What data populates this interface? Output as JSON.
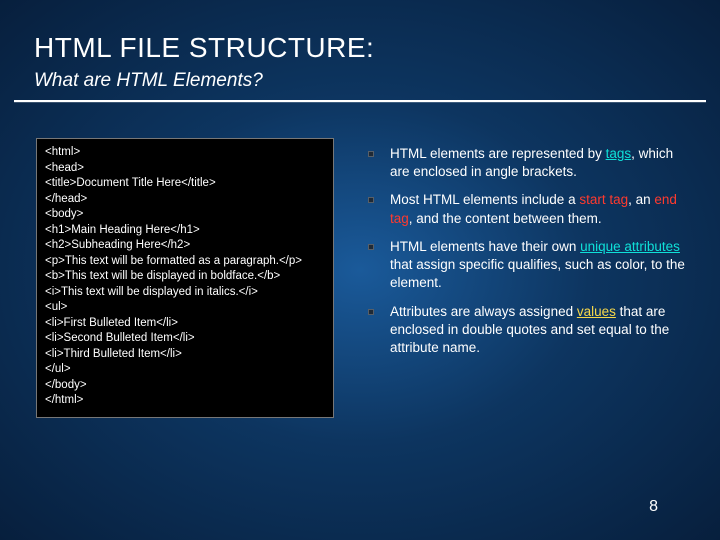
{
  "header": {
    "title": "HTML FILE STRUCTURE:",
    "subtitle": "What are HTML Elements?"
  },
  "code": {
    "lines": [
      "<html>",
      "<head>",
      "<title>Document Title Here</title>",
      "</head>",
      "",
      "<body>",
      "<h1>Main Heading Here</h1>",
      "<h2>Subheading Here</h2>",
      "",
      "<p>This text will be formatted as a paragraph.</p>",
      "<b>This text will be displayed in boldface.</b>",
      "<i>This text will be displayed in italics.</i>",
      "",
      "<ul>",
      "<li>First Bulleted Item</li>",
      "<li>Second Bulleted Item</li>",
      "<li>Third Bulleted Item</li>",
      "</ul>",
      "</body>",
      "</html>"
    ]
  },
  "bullets": [
    {
      "pre": "HTML elements are represented by ",
      "hl": "tags",
      "hl_class": "hl-cyan ul",
      "post": ", which are enclosed in angle brackets."
    },
    {
      "pre": "Most HTML elements include a ",
      "hl": "start tag",
      "hl_class": "hl-red",
      "mid": ", an ",
      "hl2": "end tag",
      "hl2_class": "hl-red",
      "post": ", and the content between them."
    },
    {
      "pre": "HTML elements have their own ",
      "hl": "unique attributes",
      "hl_class": "hl-cyan ul",
      "post": " that assign specific qualifies, such as color, to the element."
    },
    {
      "pre": "Attributes are always assigned ",
      "hl": "values",
      "hl_class": "hl-yellow ul",
      "post": " that are enclosed in double quotes and set equal to the attribute name."
    }
  ],
  "page_number": "8"
}
